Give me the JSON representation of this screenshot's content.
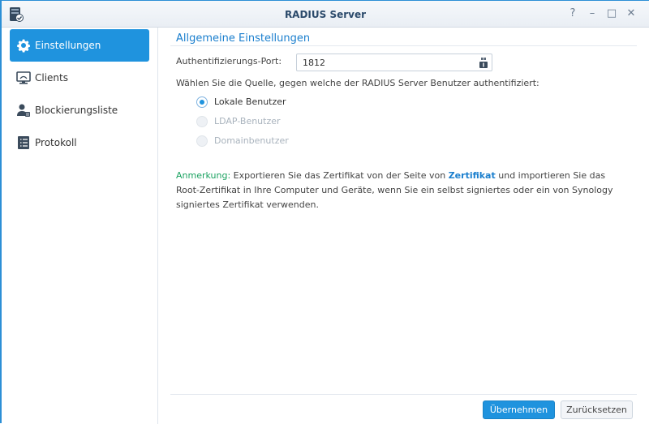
{
  "window": {
    "title": "RADIUS Server",
    "controls": [
      "?",
      "–",
      "□",
      "✕"
    ]
  },
  "sidebar": {
    "items": [
      {
        "label": "Einstellungen",
        "icon": "gear-icon",
        "active": true
      },
      {
        "label": "Clients",
        "icon": "monitor-icon",
        "active": false
      },
      {
        "label": "Blockierungsliste",
        "icon": "user-block-icon",
        "active": false
      },
      {
        "label": "Protokoll",
        "icon": "log-list-icon",
        "active": false
      }
    ]
  },
  "main": {
    "section_title": "Allgemeine Einstellungen",
    "port_label": "Authentifizierungs-Port:",
    "port_value": "1812",
    "source_label": "Wählen Sie die Quelle, gegen welche der RADIUS Server Benutzer authentifiziert:",
    "options": [
      {
        "label": "Lokale Benutzer",
        "checked": true,
        "disabled": false
      },
      {
        "label": "LDAP-Benutzer",
        "checked": false,
        "disabled": true
      },
      {
        "label": "Domainbenutzer",
        "checked": false,
        "disabled": true
      }
    ],
    "note": {
      "prefix": "Anmerkung:",
      "text1": " Exportieren Sie das Zertifikat von der Seite von ",
      "link": "Zertifikat",
      "text2": " und importieren Sie das Root-Zertifikat in Ihre Computer und Geräte, wenn Sie ein selbst signiertes oder ein von Synology signiertes Zertifikat verwenden."
    }
  },
  "footer": {
    "apply_label": "Übernehmen",
    "reset_label": "Zurücksetzen"
  },
  "colors": {
    "accent": "#1f93de",
    "title_blue": "#1b7fce",
    "note_green": "#1aa260"
  }
}
